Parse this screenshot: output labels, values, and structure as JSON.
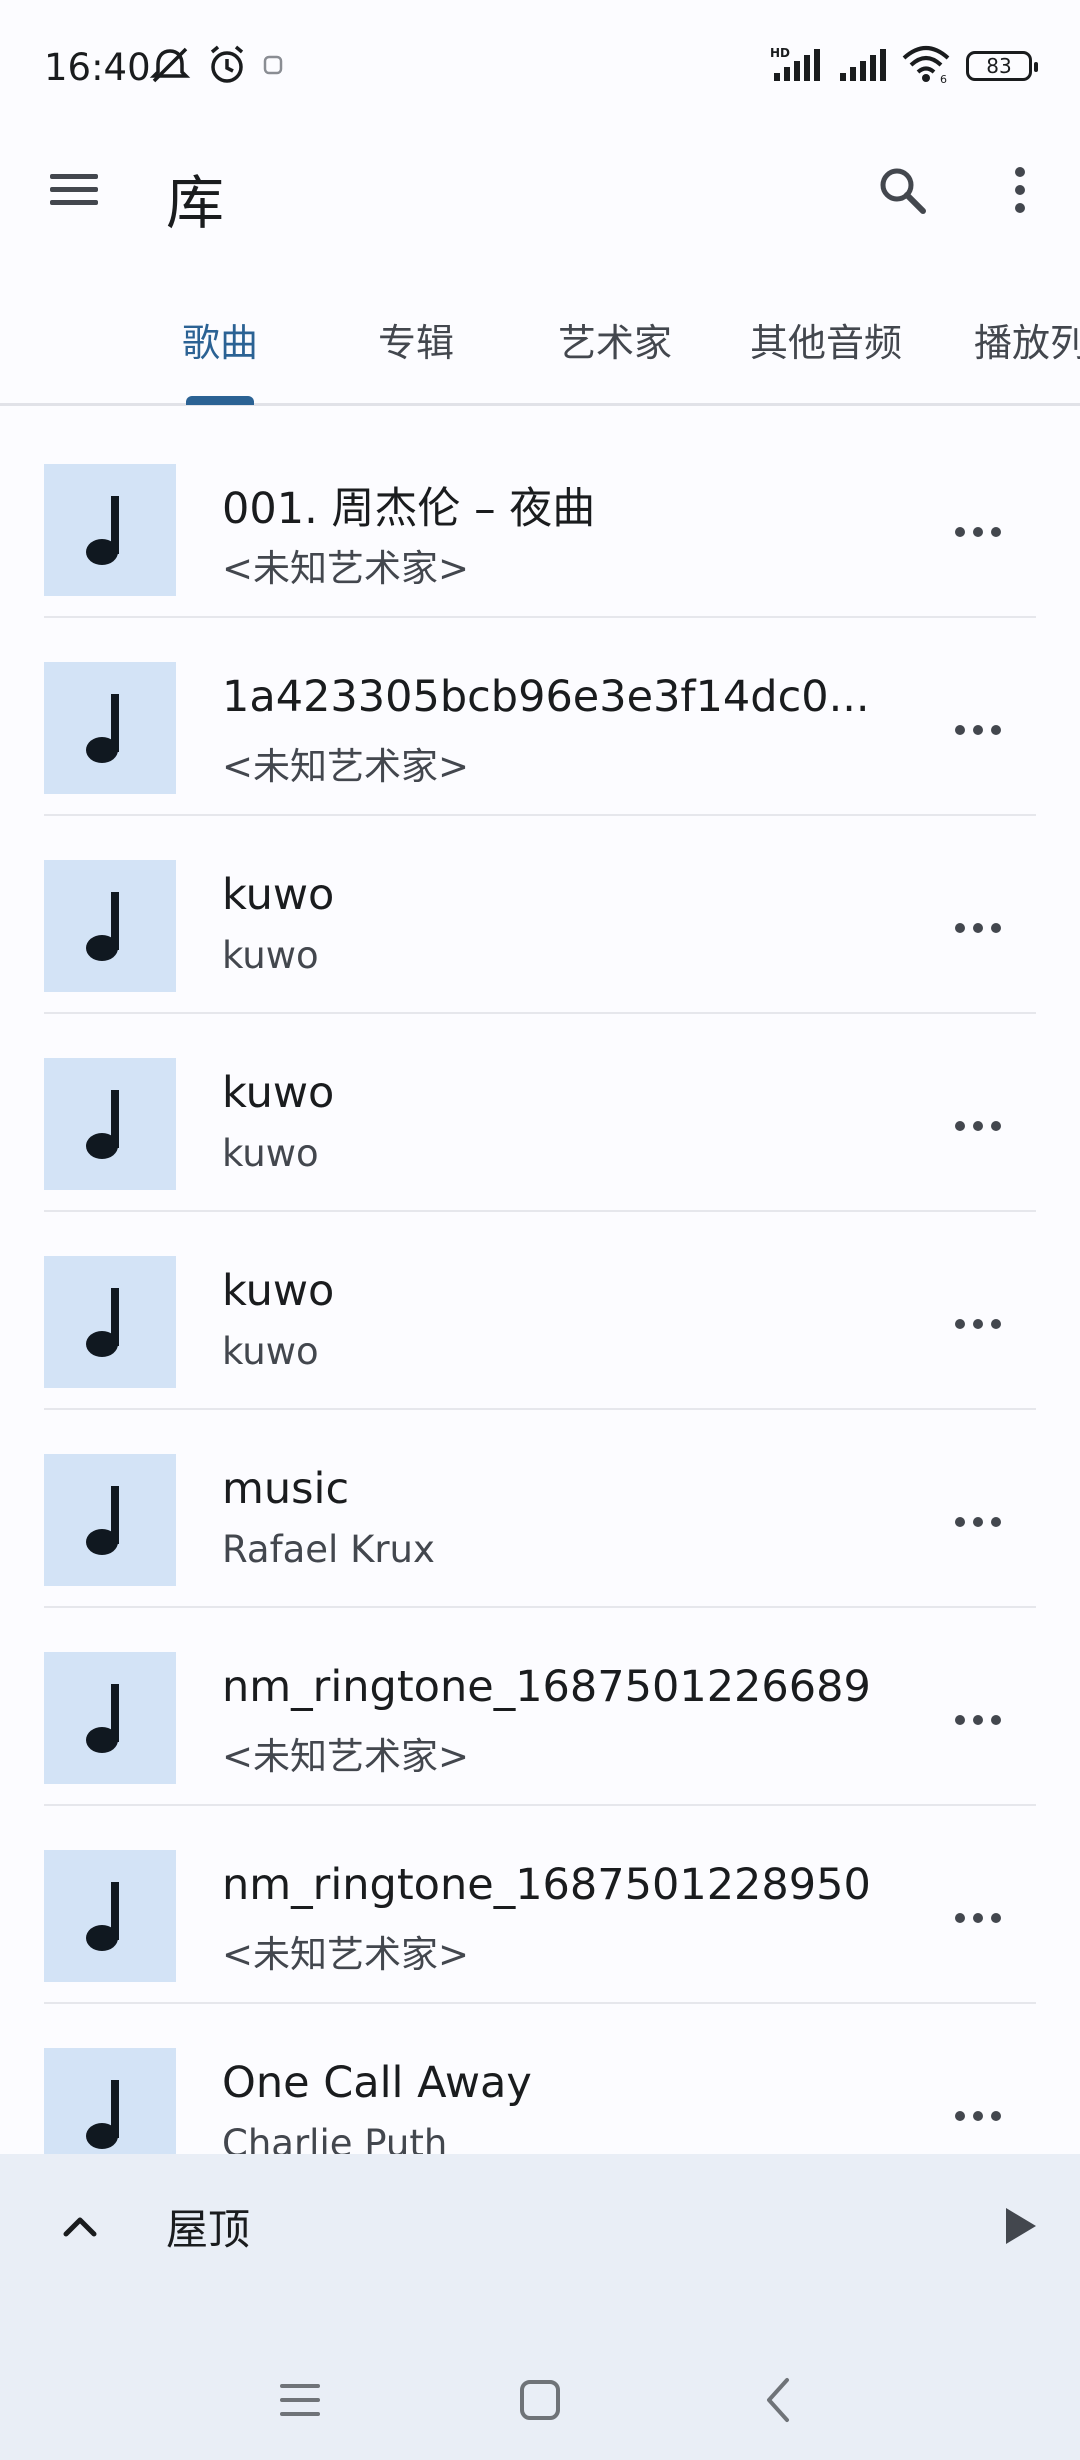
{
  "status_bar": {
    "time": "16:40",
    "battery": "83",
    "icons": [
      "mute-icon",
      "alarm-icon",
      "notification-icon",
      "hd-signal-icon",
      "signal-icon",
      "wifi-icon",
      "battery-icon"
    ]
  },
  "app_bar": {
    "title": "库",
    "icons": [
      "menu-icon",
      "search-icon",
      "more-vert-icon"
    ]
  },
  "tabs": [
    {
      "label": "歌曲",
      "active": true
    },
    {
      "label": "专辑",
      "active": false
    },
    {
      "label": "艺术家",
      "active": false
    },
    {
      "label": "其他音频",
      "active": false
    },
    {
      "label": "播放列",
      "active": false
    }
  ],
  "songs": [
    {
      "title": "001. 周杰伦 – 夜曲",
      "artist": "<未知艺术家>"
    },
    {
      "title": "1a423305bcb96e3e3f14dc0...",
      "artist": "<未知艺术家>"
    },
    {
      "title": "kuwo",
      "artist": "kuwo"
    },
    {
      "title": "kuwo",
      "artist": "kuwo"
    },
    {
      "title": "kuwo",
      "artist": "kuwo"
    },
    {
      "title": "music",
      "artist": "Rafael Krux"
    },
    {
      "title": "nm_ringtone_1687501226689",
      "artist": "<未知艺术家>"
    },
    {
      "title": "nm_ringtone_1687501228950",
      "artist": "<未知艺术家>"
    },
    {
      "title": "One Call Away",
      "artist": "Charlie Puth"
    }
  ],
  "mini_player": {
    "title": "屋顶",
    "icons": [
      "chevron-up-icon",
      "play-icon"
    ]
  },
  "nav_bar": {
    "icons": [
      "recents-icon",
      "home-icon",
      "back-icon"
    ]
  },
  "colors": {
    "accent": "#2b6294",
    "art_bg": "#d3e3f6",
    "player_bg": "#e9eef6",
    "background": "#fcfcff"
  }
}
